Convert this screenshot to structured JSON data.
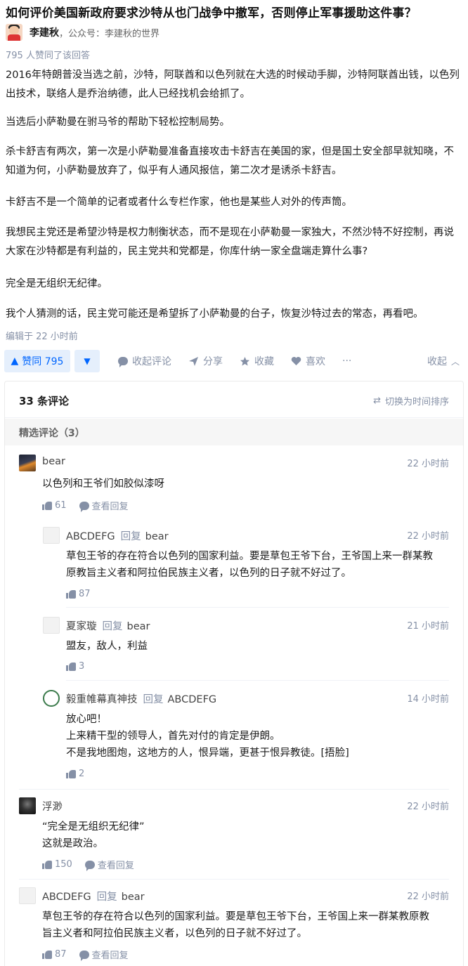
{
  "question": {
    "title": "如何评价美国新政府要求沙特从也门战争中撤军，否则停止军事援助这件事？"
  },
  "author": {
    "name": "李建秋",
    "bio": "，公众号：李建秋的世界"
  },
  "answer": {
    "voters": "795 人赞同了该回答",
    "paragraphs": [
      "2016年特朗普没当选之前，沙特，阿联酋和以色列就在大选的时候动手脚，沙特阿联酋出钱，以色列出技术，联络人是乔治纳德，此人已经找机会给抓了。",
      "当选后小萨勒曼在驸马爷的帮助下轻松控制局势。",
      "杀卡舒吉有两次，第一次是小萨勒曼准备直接攻击卡舒吉在美国的家，但是国土安全部早就知晓，不知道为何，小萨勒曼放弃了，似乎有人通风报信，第二次才是诱杀卡舒吉。",
      "卡舒吉不是一个简单的记者或者什么专栏作家，他也是某些人对外的传声筒。",
      "我想民主党还是希望沙特是权力制衡状态，而不是现在小萨勒曼一家独大，不然沙特不好控制，再说大家在沙特都是有利益的，民主党共和党都是，你库什纳一家全盘端走算什么事?",
      "完全是无组织无纪律。",
      "我个人猜测的话，民主党可能还是希望拆了小萨勒曼的台子，恢复沙特过去的常态，再看吧。"
    ],
    "edited": "编辑于 22 小时前"
  },
  "actions": {
    "vote_label": "赞同 795",
    "collapse_comments": "收起评论",
    "share": "分享",
    "favorite": "收藏",
    "like": "喜欢",
    "more": "···",
    "collapse": "收起"
  },
  "comments": {
    "count_label": "33 条评论",
    "sort_label": "切换为时间排序",
    "featured_label": "精选评论（3）",
    "reply_word": "回复",
    "view_replies": "查看回复",
    "items": [
      {
        "author": "bear",
        "time": "22 小时前",
        "text": [
          "以色列和王爷们如胶似漆呀"
        ],
        "likes": "61"
      },
      {
        "author": "ABCDEFG",
        "reply_to": "bear",
        "time": "22 小时前",
        "text": [
          "草包王爷的存在符合以色列的国家利益。要是草包王爷下台，王爷国上来一群某教",
          "原教旨主义者和阿拉伯民族主义者，以色列的日子就不好过了。"
        ],
        "likes": "87"
      },
      {
        "author": "夏家璇",
        "reply_to": "bear",
        "time": "21 小时前",
        "text": [
          "盟友，敌人，利益"
        ],
        "likes": "3"
      },
      {
        "author": "毅重帷幕真神技",
        "reply_to": "ABCDEFG",
        "time": "14 小时前",
        "text": [
          "放心吧！",
          "上来精干型的领导人，首先对付的肯定是伊朗。",
          "不是我地图炮，这地方的人，恨异端，更甚于恨异教徒。[捂脸]"
        ],
        "likes": "2"
      },
      {
        "author": "浮渺",
        "time": "22 小时前",
        "text": [
          "“完全是无组织无纪律”",
          "这就是政治。"
        ],
        "likes": "150"
      },
      {
        "author": "ABCDEFG",
        "reply_to": "bear",
        "time": "22 小时前",
        "text": [
          "草包王爷的存在符合以色列的国家利益。要是草包王爷下台，王爷国上来一群某教原教",
          "旨主义者和阿拉伯民族主义者，以色列的日子就不好过了。"
        ],
        "likes": "87"
      }
    ]
  },
  "colors": {
    "accent": "#0066ff",
    "accent_bg": "#e5effc",
    "muted": "#8590a6"
  }
}
